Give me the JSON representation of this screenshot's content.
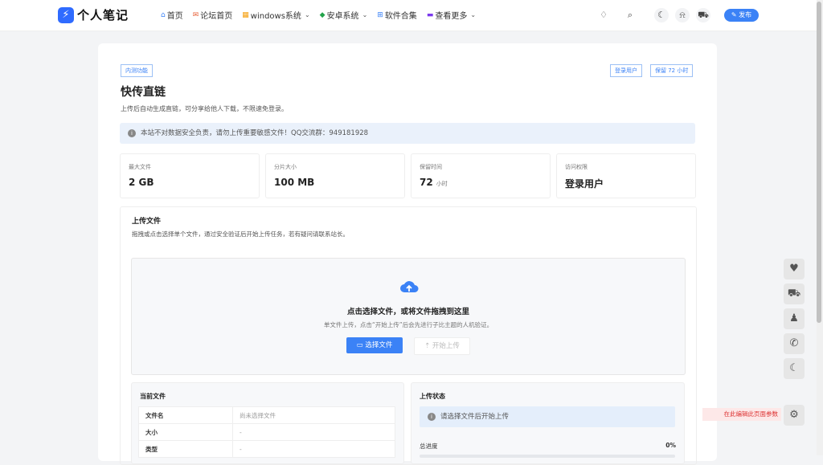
{
  "logo": {
    "mark": "⚡",
    "text": "个人笔记"
  },
  "nav": [
    {
      "label": "首页",
      "icon": "home-icon",
      "glyph": "⌂",
      "color": "#3b82f6",
      "dropdown": false
    },
    {
      "label": "论坛首页",
      "icon": "forum-icon",
      "glyph": "✉",
      "color": "#e8623a",
      "dropdown": false
    },
    {
      "label": "windows系统",
      "icon": "windows-icon",
      "glyph": "▦",
      "color": "#f59e0b",
      "dropdown": true
    },
    {
      "label": "安卓系统",
      "icon": "android-icon",
      "glyph": "◆",
      "color": "#22a34a",
      "dropdown": true
    },
    {
      "label": "软件合集",
      "icon": "apps-icon",
      "glyph": "⊞",
      "color": "#3b82f6",
      "dropdown": false
    },
    {
      "label": "查看更多",
      "icon": "more-icon",
      "glyph": "▬",
      "color": "#7c3aed",
      "dropdown": true
    }
  ],
  "toolbar": {
    "publish": "发布"
  },
  "page": {
    "badge_left": "内测功能",
    "badge_login": "登录用户",
    "badge_keep": "保留 72 小时",
    "title": "快传直链",
    "subtitle": "上传后自动生成直链，可分享给他人下载，不限速免登录。",
    "notice": "本站不对数据安全负责，请勿上传重要敏感文件！QQ交流群：949181928"
  },
  "stats": [
    {
      "label": "最大文件",
      "value": "2 GB",
      "unit": ""
    },
    {
      "label": "分片大小",
      "value": "100 MB",
      "unit": ""
    },
    {
      "label": "保留时间",
      "value": "72",
      "unit": "小时"
    },
    {
      "label": "访问权限",
      "value": "登录用户",
      "unit": ""
    }
  ],
  "upload": {
    "title": "上传文件",
    "subtitle": "拖拽或点击选择单个文件，通过安全验证后开始上传任务，若有疑问请联系站长。",
    "dz_title": "点击选择文件，或将文件拖拽到这里",
    "dz_sub": "单文件上传，点击“开始上传”后会先进行子比主题的人机验证。",
    "select_btn": "选择文件",
    "start_btn": "开始上传"
  },
  "current_file": {
    "title": "当前文件",
    "rows": [
      {
        "key": "文件名",
        "value": "尚未选择文件"
      },
      {
        "key": "大小",
        "value": "-"
      },
      {
        "key": "类型",
        "value": "-"
      }
    ]
  },
  "upload_status": {
    "title": "上传状态",
    "message": "请选择文件后开始上传",
    "progress_label": "总进度",
    "progress_text": "0%",
    "progress": 0
  },
  "edit_hint": "在此编辑此页面参数"
}
